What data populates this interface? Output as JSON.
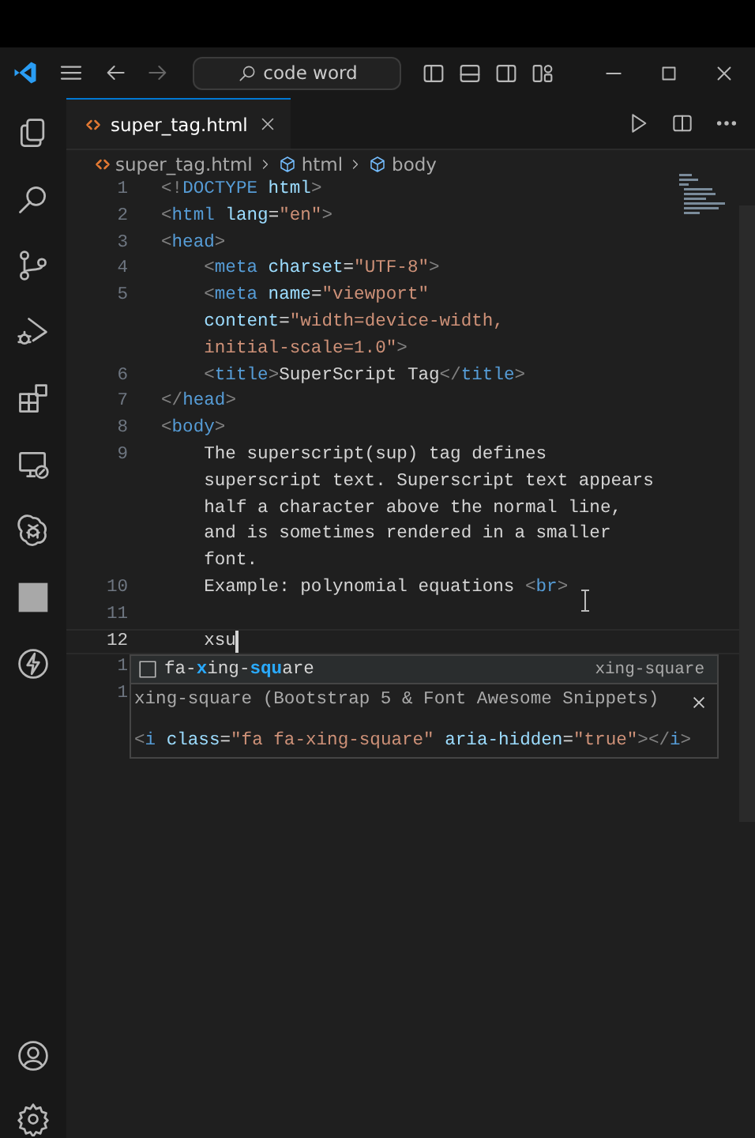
{
  "title_bar": {
    "search": {
      "value": "code word"
    }
  },
  "tabs": [
    {
      "label": "super_tag.html",
      "selected": true
    }
  ],
  "breadcrumb": [
    {
      "label": "super_tag.html",
      "kind": "file"
    },
    {
      "label": "html",
      "kind": "element"
    },
    {
      "label": "body",
      "kind": "element"
    }
  ],
  "code_lines": [
    {
      "number": "1",
      "rows": [
        {
          "tokens": [
            {
              "kind": "punct",
              "text": "<!"
            },
            {
              "kind": "tag",
              "text": "DOCTYPE"
            },
            {
              "kind": "attr",
              "text": " html"
            },
            {
              "kind": "punct",
              "text": ">"
            }
          ]
        }
      ]
    },
    {
      "number": "2",
      "rows": [
        {
          "tokens": [
            {
              "kind": "punct",
              "text": "<"
            },
            {
              "kind": "tag",
              "text": "html"
            },
            {
              "kind": "attr",
              "text": " lang"
            },
            {
              "kind": "text",
              "text": "="
            },
            {
              "kind": "str",
              "text": "\"en\""
            },
            {
              "kind": "punct",
              "text": ">"
            }
          ]
        }
      ]
    },
    {
      "number": "3",
      "rows": [
        {
          "tokens": [
            {
              "kind": "punct",
              "text": "<"
            },
            {
              "kind": "tag",
              "text": "head"
            },
            {
              "kind": "punct",
              "text": ">"
            }
          ]
        }
      ]
    },
    {
      "number": "4",
      "rows": [
        {
          "tokens": [
            {
              "kind": "punct",
              "text": "    <"
            },
            {
              "kind": "tag",
              "text": "meta"
            },
            {
              "kind": "attr",
              "text": " charset"
            },
            {
              "kind": "text",
              "text": "="
            },
            {
              "kind": "str",
              "text": "\"UTF-8\""
            },
            {
              "kind": "punct",
              "text": ">"
            }
          ]
        }
      ]
    },
    {
      "number": "5",
      "rows": [
        {
          "tokens": [
            {
              "kind": "punct",
              "text": "    <"
            },
            {
              "kind": "tag",
              "text": "meta"
            },
            {
              "kind": "attr",
              "text": " name"
            },
            {
              "kind": "text",
              "text": "="
            },
            {
              "kind": "str",
              "text": "\"viewport\""
            }
          ]
        },
        {
          "tokens": [
            {
              "kind": "attr",
              "text": "    content"
            },
            {
              "kind": "text",
              "text": "="
            },
            {
              "kind": "str",
              "text": "\"width=device-width,"
            }
          ]
        },
        {
          "tokens": [
            {
              "kind": "str",
              "text": "    initial-scale=1.0\""
            },
            {
              "kind": "punct",
              "text": ">"
            }
          ]
        }
      ]
    },
    {
      "number": "6",
      "rows": [
        {
          "tokens": [
            {
              "kind": "punct",
              "text": "    <"
            },
            {
              "kind": "tag",
              "text": "title"
            },
            {
              "kind": "punct",
              "text": ">"
            },
            {
              "kind": "text",
              "text": "SuperScript Tag"
            },
            {
              "kind": "punct",
              "text": "</"
            },
            {
              "kind": "tag",
              "text": "title"
            },
            {
              "kind": "punct",
              "text": ">"
            }
          ]
        }
      ]
    },
    {
      "number": "7",
      "rows": [
        {
          "tokens": [
            {
              "kind": "punct",
              "text": "</"
            },
            {
              "kind": "tag",
              "text": "head"
            },
            {
              "kind": "punct",
              "text": ">"
            }
          ]
        }
      ]
    },
    {
      "number": "8",
      "rows": [
        {
          "tokens": [
            {
              "kind": "punct",
              "text": "<"
            },
            {
              "kind": "tag",
              "text": "body"
            },
            {
              "kind": "punct",
              "text": ">"
            }
          ]
        }
      ]
    },
    {
      "number": "9",
      "rows": [
        {
          "tokens": [
            {
              "kind": "text",
              "text": "    The superscript(sup) tag defines"
            }
          ]
        },
        {
          "tokens": [
            {
              "kind": "text",
              "text": "    superscript text. Superscript text appears"
            }
          ]
        },
        {
          "tokens": [
            {
              "kind": "text",
              "text": "    half a character above the normal line,"
            }
          ]
        },
        {
          "tokens": [
            {
              "kind": "text",
              "text": "    and is sometimes rendered in a smaller"
            }
          ]
        },
        {
          "tokens": [
            {
              "kind": "text",
              "text": "    font."
            }
          ]
        }
      ]
    },
    {
      "number": "10",
      "rows": [
        {
          "tokens": [
            {
              "kind": "text",
              "text": "    Example: polynomial equations "
            },
            {
              "kind": "punct",
              "text": "<"
            },
            {
              "kind": "tag",
              "text": "br"
            },
            {
              "kind": "punct",
              "text": ">"
            }
          ]
        }
      ]
    },
    {
      "number": "11"
    },
    {
      "number": "12",
      "current": true,
      "rows": [
        {
          "tokens": [
            {
              "kind": "text",
              "text": "    xsu"
            }
          ]
        }
      ]
    },
    {
      "number": "1"
    },
    {
      "number": "1"
    }
  ],
  "suggestion": {
    "label_parts": [
      {
        "text": "fa-",
        "match": false
      },
      {
        "text": "x",
        "match": true
      },
      {
        "text": "ing-",
        "match": false
      },
      {
        "text": "s",
        "match": true
      },
      {
        "text": "qu",
        "match": true
      },
      {
        "text": "are",
        "match": false
      }
    ],
    "detail": "xing-square",
    "doc_title": "xing-square (Bootstrap 5 & Font Awesome Snippets)",
    "snippet": [
      {
        "kind": "punct",
        "text": "<"
      },
      {
        "kind": "tag",
        "text": "i"
      },
      {
        "kind": "attr",
        "text": " class"
      },
      {
        "kind": "text",
        "text": "="
      },
      {
        "kind": "str",
        "text": "\"fa fa-xing-square\""
      },
      {
        "kind": "attr",
        "text": " aria-hidden"
      },
      {
        "kind": "text",
        "text": "="
      },
      {
        "kind": "str",
        "text": "\"true\""
      },
      {
        "kind": "punct",
        "text": "></"
      },
      {
        "kind": "tag",
        "text": "i"
      },
      {
        "kind": "punct",
        "text": ">"
      }
    ]
  }
}
